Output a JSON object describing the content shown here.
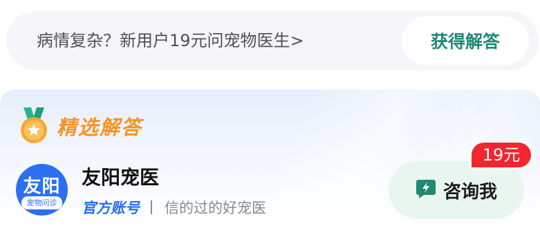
{
  "promo": {
    "text": "病情复杂？新用户19元问宠物医生>",
    "button_label": "获得解答"
  },
  "section": {
    "title": "精选解答",
    "accent_color": "#f59323"
  },
  "doctor": {
    "avatar_main": "友阳",
    "avatar_sub": "宠物问诊",
    "name": "友阳宠医",
    "badge": "官方账号",
    "slogan": "信的过的好宠医"
  },
  "consult": {
    "price": "19元",
    "label": "咨询我",
    "icon": "lightning-chat-icon"
  },
  "colors": {
    "brand_green": "#1d8a72",
    "brand_blue": "#2a6df0",
    "price_red": "#f1262f"
  }
}
